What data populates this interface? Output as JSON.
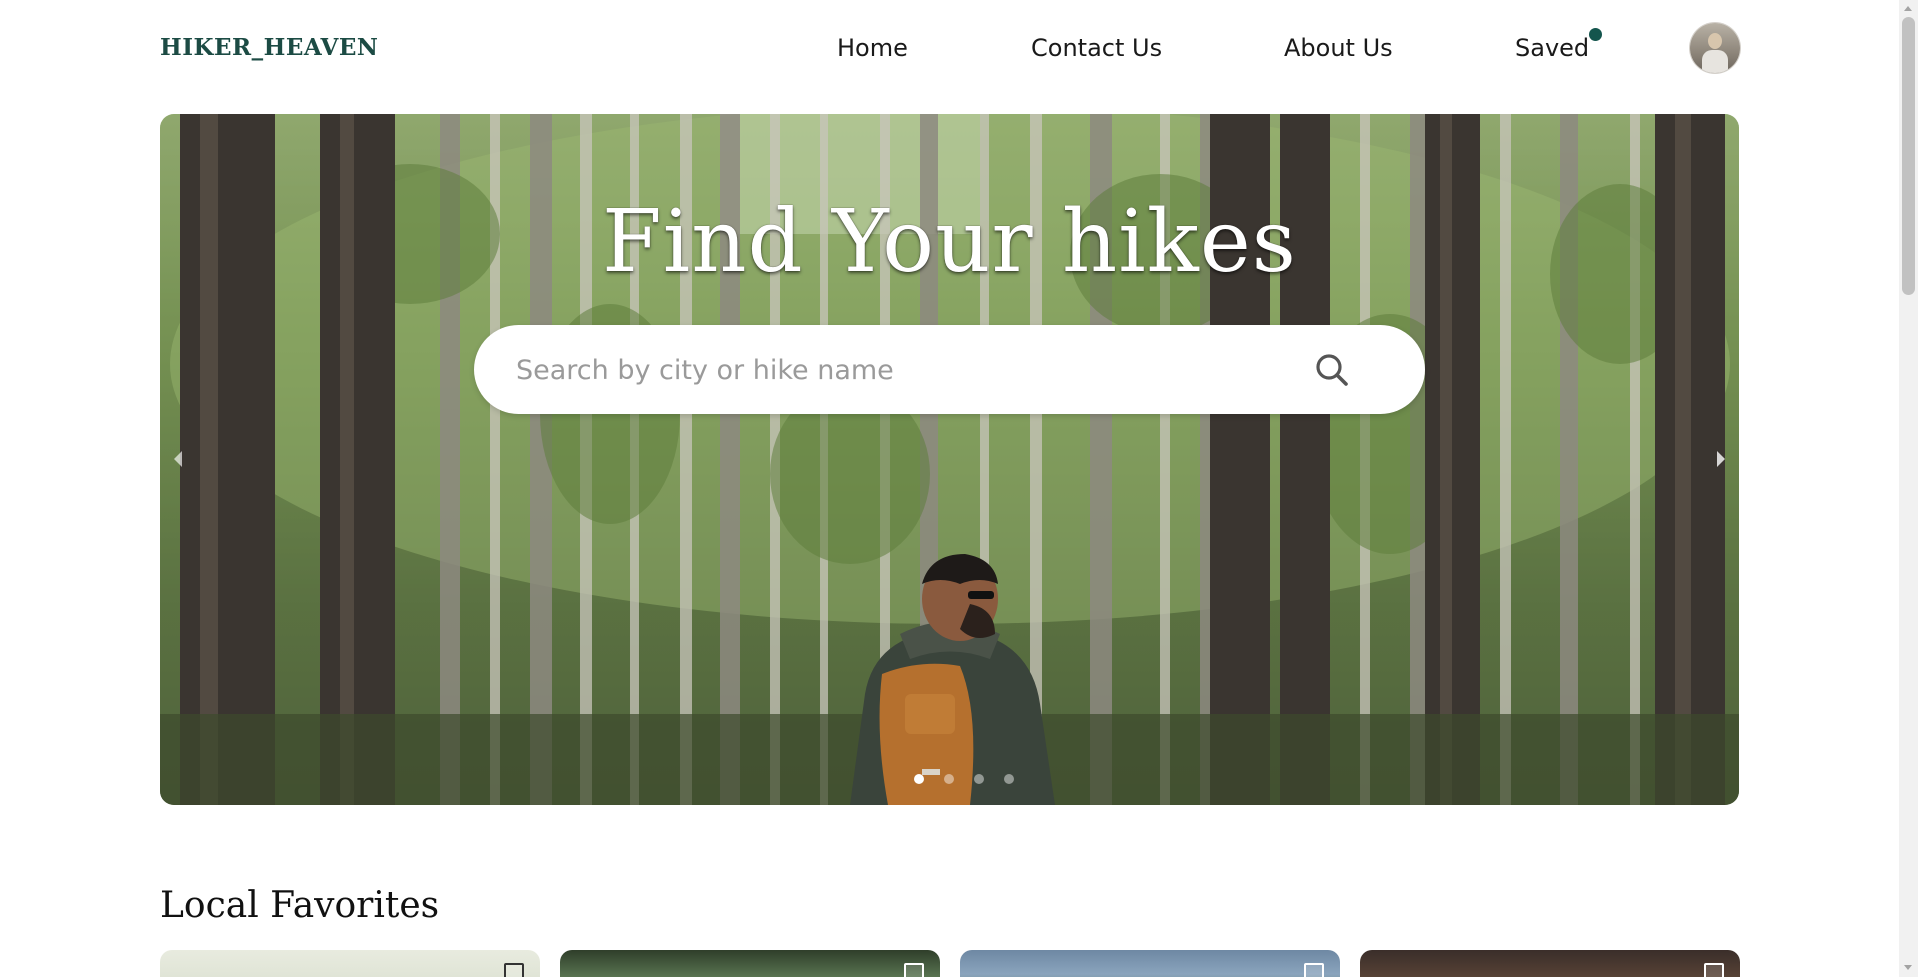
{
  "header": {
    "logo": "HIKER_HEAVEN",
    "nav": {
      "home": "Home",
      "contact": "Contact Us",
      "about": "About Us",
      "saved": "Saved"
    },
    "saved_badge_color": "#14554d",
    "avatar_icon": "user-avatar"
  },
  "hero": {
    "title": "Find Your hikes",
    "search": {
      "placeholder": "Search by city or hike name",
      "value": "",
      "icon": "search-icon"
    },
    "carousel": {
      "slide_count": 4,
      "active_slide": 1,
      "prev_icon": "chevron-left-icon",
      "next_icon": "chevron-right-icon"
    }
  },
  "local_favorites": {
    "title": "Local Favorites",
    "card_count_visible": 4,
    "card_icon": "bookmark-icon"
  },
  "colors": {
    "brand": "#1c4b44",
    "accent": "#14554d",
    "text": "#1a1a1a"
  }
}
